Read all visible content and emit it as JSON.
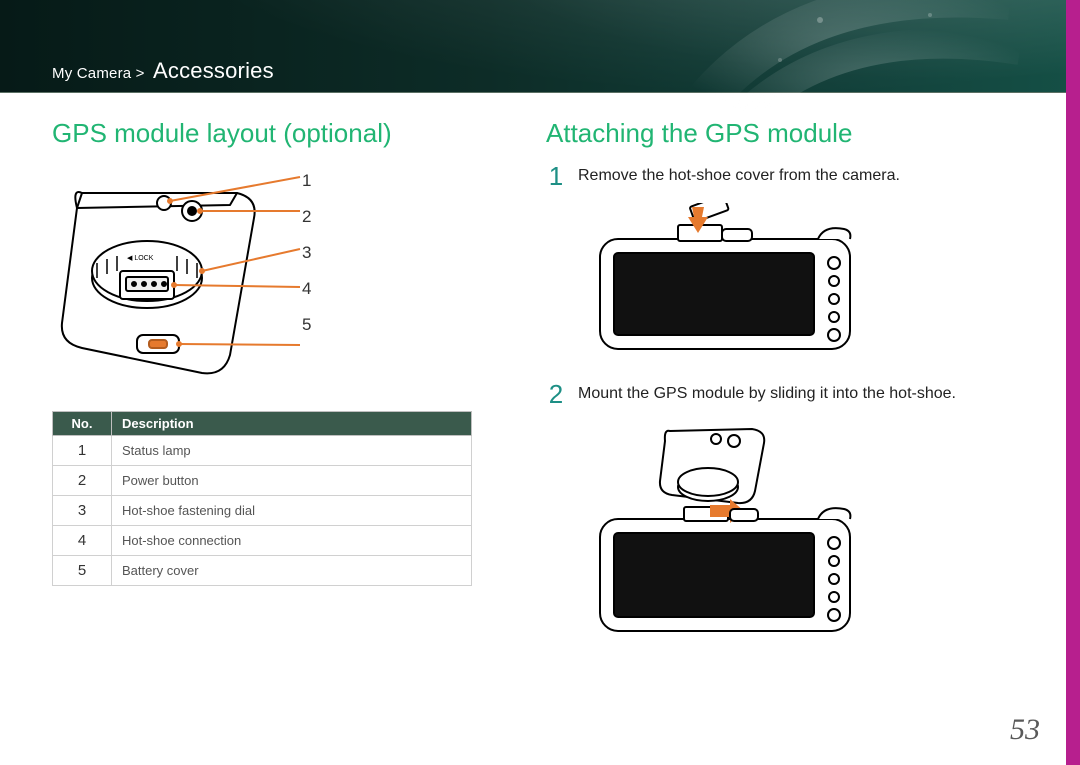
{
  "breadcrumb": {
    "path": "My Camera >",
    "section": "Accessories"
  },
  "left": {
    "heading": "GPS module layout (optional)",
    "callout_numbers": [
      "1",
      "2",
      "3",
      "4",
      "5"
    ],
    "table": {
      "head_no": "No.",
      "head_desc": "Description",
      "rows": [
        {
          "no": "1",
          "desc": "Status lamp"
        },
        {
          "no": "2",
          "desc": "Power button"
        },
        {
          "no": "3",
          "desc": "Hot-shoe fastening dial"
        },
        {
          "no": "4",
          "desc": "Hot-shoe connection"
        },
        {
          "no": "5",
          "desc": "Battery cover"
        }
      ]
    }
  },
  "right": {
    "heading": "Attaching the GPS module",
    "steps": [
      {
        "n": "1",
        "text": "Remove the hot-shoe cover from the camera."
      },
      {
        "n": "2",
        "text": "Mount the GPS module by sliding it into the hot-shoe."
      }
    ]
  },
  "page_number": "53"
}
